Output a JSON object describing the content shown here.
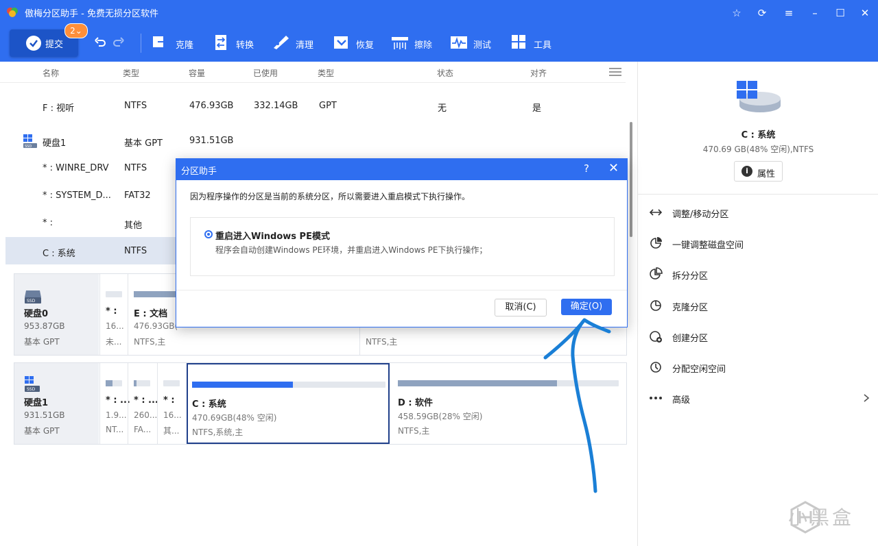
{
  "window": {
    "title": "傲梅分区助手 - 免费无损分区软件"
  },
  "toolbar": {
    "submit_label": "提交",
    "pending_count": "2",
    "items": [
      {
        "label": "克隆",
        "icon": "clone-icon"
      },
      {
        "label": "转换",
        "icon": "convert-icon"
      },
      {
        "label": "清理",
        "icon": "clean-icon"
      },
      {
        "label": "恢复",
        "icon": "recover-icon"
      },
      {
        "label": "擦除",
        "icon": "wipe-icon"
      },
      {
        "label": "测试",
        "icon": "test-icon"
      },
      {
        "label": "工具",
        "icon": "tools-icon"
      }
    ]
  },
  "table": {
    "headers": [
      "名称",
      "类型",
      "容量",
      "已使用",
      "类型",
      "状态",
      "对齐"
    ],
    "rows": [
      {
        "name": "F : 视听",
        "type": "NTFS",
        "capacity": "476.93GB",
        "used": "332.14GB",
        "ptype": "GPT",
        "status": "无",
        "align": "是"
      },
      {
        "name": "硬盘1",
        "type": "基本 GPT",
        "capacity": "931.51GB",
        "used": "",
        "ptype": "",
        "status": "",
        "align": ""
      },
      {
        "name": "* : WINRE_DRV",
        "type": "NTFS",
        "capacity": "",
        "used": "",
        "ptype": "",
        "status": "",
        "align": ""
      },
      {
        "name": "* : SYSTEM_D...",
        "type": "FAT32",
        "capacity": "",
        "used": "",
        "ptype": "",
        "status": "",
        "align": ""
      },
      {
        "name": "* :",
        "type": "其他",
        "capacity": "",
        "used": "",
        "ptype": "",
        "status": "",
        "align": ""
      },
      {
        "name": "C : 系统",
        "type": "NTFS",
        "capacity": "",
        "used": "",
        "ptype": "",
        "status": "",
        "align": ""
      }
    ]
  },
  "disk0": {
    "name": "硬盘0",
    "size": "953.87GB",
    "type": "基本 GPT",
    "partitions": [
      {
        "name": "* :",
        "size": "16...",
        "fs": "未..."
      },
      {
        "name": "E : 文档",
        "size": "476.93GB(",
        "fs": "NTFS,主"
      },
      {
        "name": "",
        "size": "",
        "fs": "NTFS,主"
      }
    ]
  },
  "disk1": {
    "name": "硬盘1",
    "size": "931.51GB",
    "type": "基本 GPT",
    "partitions": [
      {
        "name": "* : ...",
        "size": "1.9...",
        "fs": "NT..."
      },
      {
        "name": "* : ...",
        "size": "260...",
        "fs": "FA..."
      },
      {
        "name": "* :",
        "size": "16...",
        "fs": "其..."
      },
      {
        "name": "C : 系统",
        "size": "470.69GB(48% 空闲)",
        "fs": "NTFS,系统,主",
        "used_fraction": 0.52
      },
      {
        "name": "D : 软件",
        "size": "458.59GB(28% 空闲)",
        "fs": "NTFS,主",
        "used_fraction": 0.72
      }
    ]
  },
  "right_panel": {
    "selected_name": "C : 系统",
    "selected_info": "470.69 GB(48% 空闲),NTFS",
    "properties_label": "属性",
    "operations": [
      {
        "label": "调整/移动分区",
        "icon": "resize-move-icon"
      },
      {
        "label": "一键调整磁盘空间",
        "icon": "quick-adjust-icon"
      },
      {
        "label": "拆分分区",
        "icon": "split-partition-icon"
      },
      {
        "label": "克隆分区",
        "icon": "clone-partition-icon"
      },
      {
        "label": "创建分区",
        "icon": "create-partition-icon"
      },
      {
        "label": "分配空闲空间",
        "icon": "allocate-space-icon"
      },
      {
        "label": "高级",
        "icon": "more-icon"
      }
    ]
  },
  "dialog": {
    "title": "分区助手",
    "help": "?",
    "message": "因为程序操作的分区是当前的系统分区，所以需要进入重启模式下执行操作。",
    "option_title": "重启进入Windows PE模式",
    "option_desc": "程序会自动创建Windows PE环境，并重启进入Windows PE下执行操作；",
    "cancel_label": "取消(C)",
    "ok_label": "确定(O)"
  },
  "watermark": {
    "text": "小黑盒"
  },
  "colors": {
    "accent": "#2f6ef0",
    "annotation": "#1a7fd6",
    "badge": "#ff8f3a"
  }
}
